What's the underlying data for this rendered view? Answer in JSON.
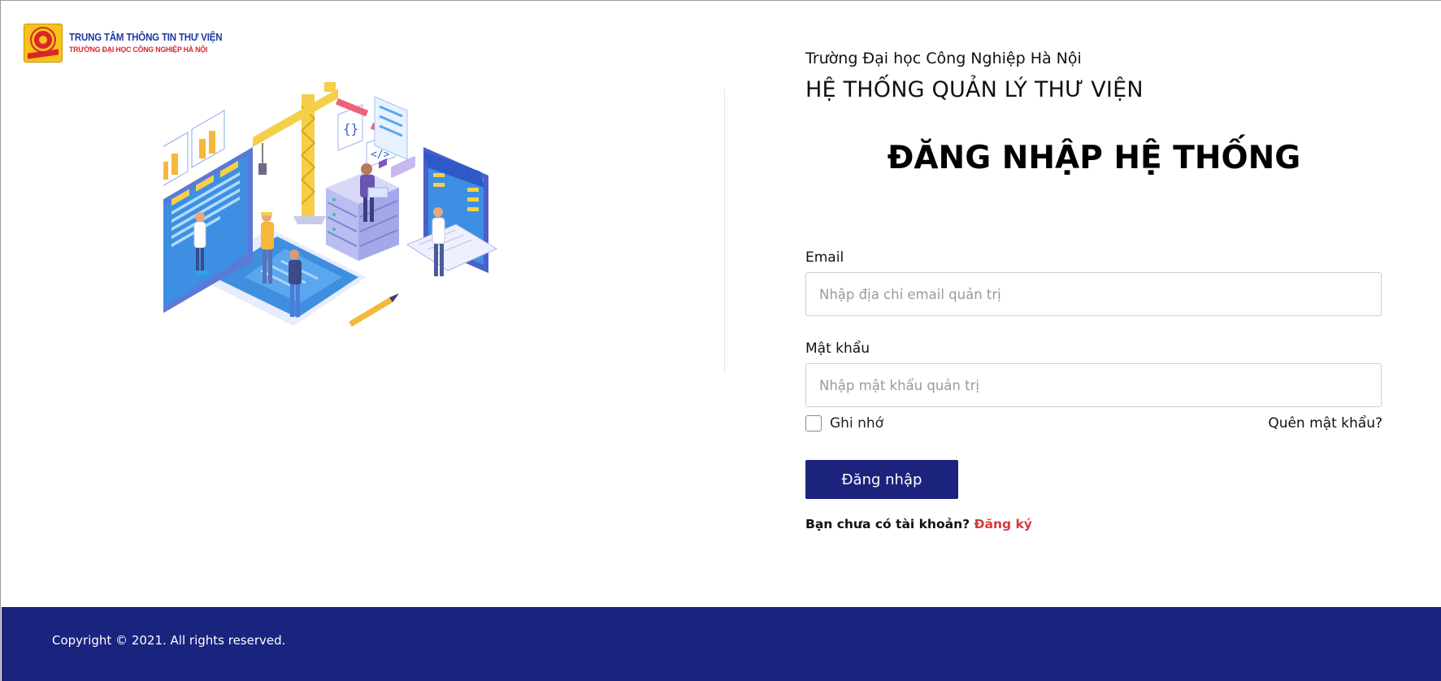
{
  "logo": {
    "line1": "TRUNG TÂM THÔNG TIN THƯ VIỆN",
    "line2": "TRƯỜNG ĐẠI HỌC CÔNG NGHIỆP HÀ NỘI"
  },
  "header": {
    "school": "Trường Đại học Công Nghiệp Hà Nội",
    "system": "HỆ THỐNG QUẢN LÝ THƯ VIỆN"
  },
  "login": {
    "title": "ĐĂNG NHẬP HỆ THỐNG",
    "email_label": "Email",
    "email_placeholder": "Nhập địa chỉ email quản trị",
    "email_value": "",
    "password_label": "Mật khẩu",
    "password_placeholder": "Nhập mật khẩu quản trị",
    "password_value": "",
    "remember_label": "Ghi nhớ",
    "remember_checked": false,
    "forgot_label": "Quên mật khẩu?",
    "submit_label": "Đăng nhập",
    "signup_prompt": "Bạn chưa có tài khoản?",
    "signup_link": "Đăng ký"
  },
  "footer": {
    "copyright": "Copyright © 2021. All rights reserved."
  },
  "colors": {
    "primary": "#1c237c",
    "footer_bg": "#1a237e",
    "link_red": "#d63a3a",
    "logo_yellow": "#f7c21a",
    "logo_red": "#d8262c",
    "logo_blue": "#1f3aa0"
  },
  "icons": {
    "illustration": "isometric-developers-illustration",
    "logo": "library-logo-icon"
  }
}
